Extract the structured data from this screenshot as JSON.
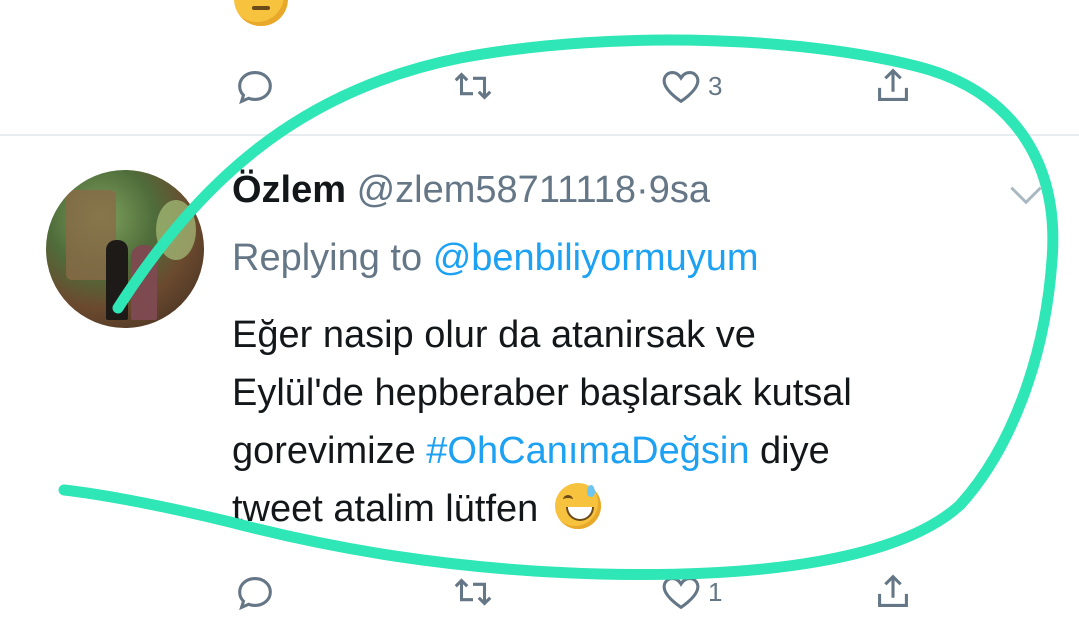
{
  "prev_tweet": {
    "like_count": "3"
  },
  "tweet": {
    "name": "Özlem",
    "handle": "@zlem58711118",
    "separator": "·",
    "time": "9sa",
    "replying_prefix": "Replying to",
    "replying_to": "@benbiliyormuyum",
    "body_line1": "Eğer nasip olur da atanirsak ve",
    "body_line2": "Eylül'de hepberaber başlarsak kutsal",
    "body_line3_before": "gorevimize",
    "hashtag": "#OhCanımaDeğsin",
    "body_line3_after": "diye",
    "body_line4": "tweet atalim lütfen",
    "like_count": "1"
  },
  "icons": {
    "reply": "reply-icon",
    "retweet": "retweet-icon",
    "like": "heart-icon",
    "share": "share-icon",
    "caret": "chevron-down-icon"
  },
  "colors": {
    "link": "#1da1f2",
    "secondary_text": "#657786",
    "annotation": "#2ee6b6"
  }
}
